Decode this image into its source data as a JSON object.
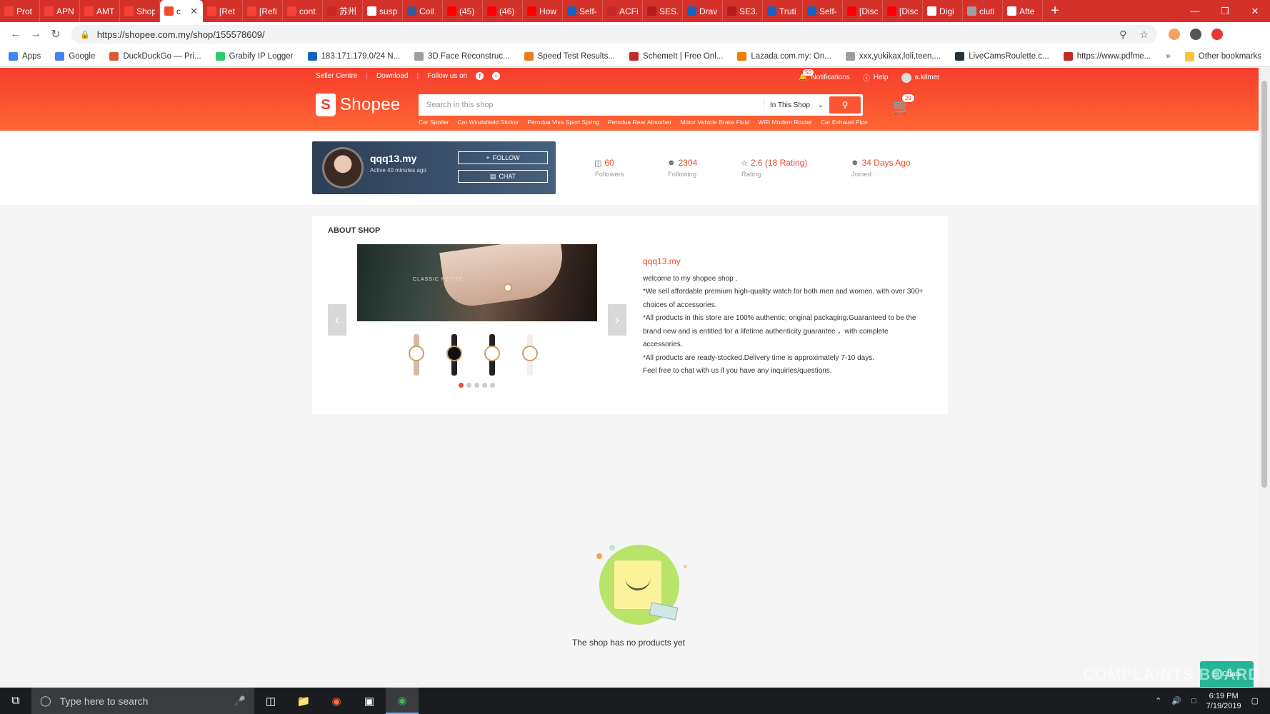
{
  "browser": {
    "tabs": [
      {
        "title": "Prot",
        "color": "#f44336"
      },
      {
        "title": "APN",
        "color": "#f44336"
      },
      {
        "title": "AMT",
        "color": "#f44336"
      },
      {
        "title": "Shop",
        "color": "#f44336"
      },
      {
        "title": "c",
        "color": "#ee4d2d",
        "active": true
      },
      {
        "title": "[Ret",
        "color": "#f44336"
      },
      {
        "title": "[Refi",
        "color": "#f44336"
      },
      {
        "title": "cont",
        "color": "#f44336"
      },
      {
        "title": "苏州",
        "color": "#c62828"
      },
      {
        "title": "susp",
        "color": "#ffffff"
      },
      {
        "title": "Coil",
        "color": "#3b5998"
      },
      {
        "title": "(45)",
        "color": "#ff0000"
      },
      {
        "title": "(46)",
        "color": "#ff0000"
      },
      {
        "title": "How",
        "color": "#ff0000"
      },
      {
        "title": "Self-",
        "color": "#1565c0"
      },
      {
        "title": "ACFi",
        "color": "#c62828"
      },
      {
        "title": "SES.p",
        "color": "#b71c1c"
      },
      {
        "title": "Drav",
        "color": "#1565c0"
      },
      {
        "title": "SE3.",
        "color": "#b71c1c"
      },
      {
        "title": "Truti",
        "color": "#1565c0"
      },
      {
        "title": "Self-",
        "color": "#1565c0"
      },
      {
        "title": "[Disc",
        "color": "#ff0000"
      },
      {
        "title": "[Disc",
        "color": "#ff0000"
      },
      {
        "title": "Digi",
        "color": "#ffffff"
      },
      {
        "title": "cluti",
        "color": "#9e9e9e"
      },
      {
        "title": "Afte",
        "color": "#ffffff"
      }
    ],
    "url": "https://shopee.com.my/shop/155578609/",
    "bookmarks": [
      {
        "label": "Apps",
        "color": "#4285f4"
      },
      {
        "label": "Google",
        "color": "#4285f4"
      },
      {
        "label": "DuckDuckGo — Pri...",
        "color": "#de5833"
      },
      {
        "label": "Grabify IP Logger",
        "color": "#2ecc71"
      },
      {
        "label": "183.171.179.0/24 N...",
        "color": "#1565c0"
      },
      {
        "label": "3D Face Reconstruc...",
        "color": "#9e9e9e"
      },
      {
        "label": "Speed Test Results...",
        "color": "#e67e22"
      },
      {
        "label": "SchemeIt | Free Onl...",
        "color": "#c62828"
      },
      {
        "label": "Lazada.com.my: On...",
        "color": "#f57c00"
      },
      {
        "label": "xxx,yukikax,loli,teen,...",
        "color": "#9e9e9e"
      },
      {
        "label": "LiveCamsRoulette.c...",
        "color": "#263238"
      },
      {
        "label": "https://www.pdfme...",
        "color": "#c62828"
      }
    ],
    "other_bookmarks": "Other bookmarks",
    "more": "»"
  },
  "shopee": {
    "topnav": [
      "Seller Centre",
      "Download",
      "Follow us on"
    ],
    "notifications": {
      "label": "Notifications",
      "count": "50"
    },
    "help": "Help",
    "username": "a.kilmer",
    "logo": "Shopee",
    "search": {
      "placeholder": "Search in this shop",
      "scope": "In This Shop"
    },
    "hints": [
      "Car Spoiler",
      "Car Windshield Sticker",
      "Perodua Viva Sport Spring",
      "Perodua Rear Absorber",
      "Motor Vehicle Brake Fluid",
      "WiFi Modem Router",
      "Car Exhaust Pipe"
    ],
    "cart_count": "29",
    "shop": {
      "name": "qqq13.my",
      "active": "Active 40 minutes ago",
      "follow": "FOLLOW",
      "chat": "CHAT"
    },
    "stats": [
      {
        "value": "60",
        "label": "Followers",
        "icon": "store-icon"
      },
      {
        "value": "2304",
        "label": "Following",
        "icon": "user-icon"
      },
      {
        "value": "2.6 (18 Rating)",
        "label": "Rating",
        "icon": "star-icon"
      },
      {
        "value": "34 Days Ago",
        "label": "Joined",
        "icon": "user-icon"
      }
    ],
    "about": {
      "title": "ABOUT SHOP",
      "banner_text": "CLASSIC PETITE",
      "shop_name": "qqq13.my",
      "lines": [
        "welcome to my shopee shop .",
        "*We sell affordable premium high-quality watch for both men and women, with over 300+ choices of accessories.",
        "*All products in this store are 100% authentic, original packaging.Guaranteed to be the brand new and is entitled for a lifetime authenticity guarantee ，with complete accessories.",
        "*All products are ready-stocked.Delivery time is approximately 7-10 days.",
        "Feel free to chat with us if you have any inquiries/questions."
      ]
    },
    "empty": "The shop has no products yet",
    "chat_float": "Chats"
  },
  "watermark": "COMPLAINTS BOARD",
  "taskbar": {
    "search_placeholder": "Type here to search",
    "time": "6:19 PM",
    "date": "7/19/2019"
  }
}
